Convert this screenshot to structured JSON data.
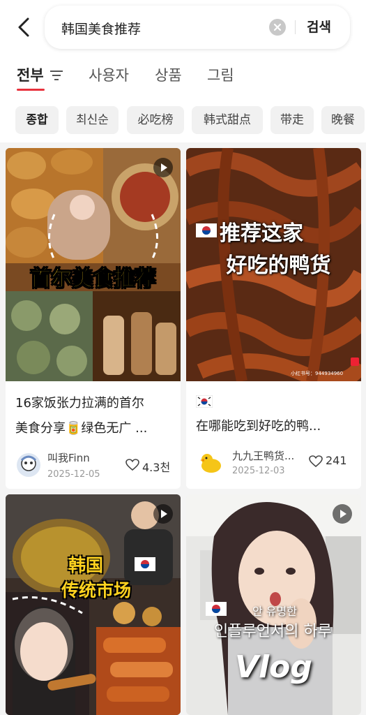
{
  "search": {
    "query": "韩国美食推荐",
    "button_label": "검색"
  },
  "tabs": [
    {
      "label": "전부",
      "active": true
    },
    {
      "label": "사용자",
      "active": false
    },
    {
      "label": "상품",
      "active": false
    },
    {
      "label": "그림",
      "active": false
    }
  ],
  "chips": [
    {
      "label": "종합",
      "active": true
    },
    {
      "label": "최신순",
      "active": false
    },
    {
      "label": "必吃榜",
      "active": false
    },
    {
      "label": "韩式甜点",
      "active": false
    },
    {
      "label": "带走",
      "active": false
    },
    {
      "label": "晚餐",
      "active": false
    }
  ],
  "posts": [
    {
      "overlay": "首尔美食推荐",
      "title_line1": "16家饭张力拉满的首尔",
      "title_line2": "美食分享🥫绿色无广 ...",
      "author": "叫我Finn",
      "date": "2025-12-05",
      "likes": "4.3천",
      "is_video": true
    },
    {
      "overlay_line1": "推荐这家",
      "overlay_line2": "好吃的鸭货",
      "watermark": "小红书号：944934960",
      "title": "在哪能吃到好吃的鸭...",
      "author": "九九王鸭货...",
      "date": "2025-12-03",
      "likes": "241",
      "is_video": false
    },
    {
      "overlay_line1": "韩国",
      "overlay_line2": "传统市场",
      "is_video": true
    },
    {
      "overlay_line1": "안 유명한",
      "overlay_line2": "인플루언서의 하루",
      "overlay_line3": "Vlog",
      "is_video": true
    }
  ],
  "colors": {
    "accent": "#e8323d",
    "overlay_yellow": "#ffd21f"
  }
}
